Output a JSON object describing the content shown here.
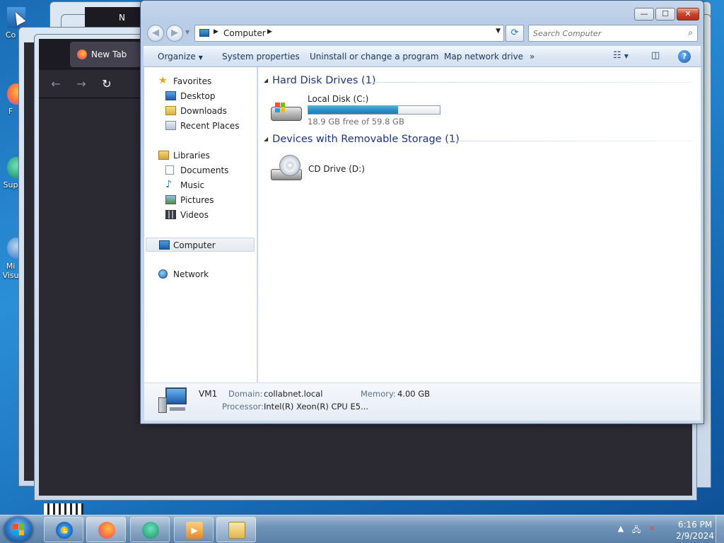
{
  "desktop": {
    "icons": [
      {
        "label": "Co"
      },
      {
        "label": "F"
      },
      {
        "label": "Sup"
      },
      {
        "label": "Mi"
      },
      {
        "label": "Visu"
      }
    ]
  },
  "firefox": {
    "tab_title": "New Tab",
    "behind_tab_1": "N",
    "behind_tab_2": "N"
  },
  "explorer": {
    "buttons": {
      "minimize": "—",
      "maximize": "☐",
      "close": "✕"
    },
    "address": {
      "crumb": "Computer"
    },
    "search": {
      "placeholder": "Search Computer"
    },
    "commands": [
      {
        "label": "Organize"
      },
      {
        "label": "System properties"
      },
      {
        "label": "Uninstall or change a program"
      },
      {
        "label": "Map network drive"
      },
      {
        "label": "»"
      }
    ],
    "nav": {
      "favorites": "Favorites",
      "desktop": "Desktop",
      "downloads": "Downloads",
      "recent": "Recent Places",
      "libraries": "Libraries",
      "documents": "Documents",
      "music": "Music",
      "pictures": "Pictures",
      "videos": "Videos",
      "computer": "Computer",
      "network": "Network"
    },
    "groups": {
      "hdd": "Hard Disk Drives (1)",
      "removable": "Devices with Removable Storage (1)"
    },
    "drives": {
      "c_name": "Local Disk (C:)",
      "c_free": "18.9 GB free of 59.8 GB",
      "c_used_fraction": 0.684,
      "d_name": "CD Drive (D:)"
    },
    "details": {
      "name": "VM1",
      "domain_label": "Domain:",
      "domain_value": "collabnet.local",
      "memory_label": "Memory:",
      "memory_value": "4.00 GB",
      "processor_label": "Processor:",
      "processor_value": "Intel(R) Xeon(R) CPU E5..."
    }
  },
  "taskbar": {
    "time": "6:16 PM",
    "date": "2/9/2024"
  },
  "colors": {
    "accent": "#1e3287",
    "drive_fill": "#2a93c9",
    "taskbar": "#6f93b8"
  }
}
